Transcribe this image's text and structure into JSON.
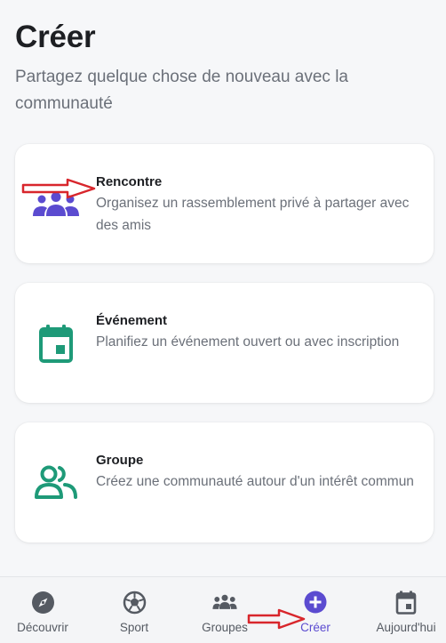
{
  "header": {
    "title": "Créer",
    "subtitle": "Partagez quelque chose de nouveau avec la communauté"
  },
  "options": [
    {
      "title": "Rencontre",
      "description": "Organisez un rassemblement privé à partager avec des amis",
      "icon": "group-people-icon",
      "color": "#5b4bd0"
    },
    {
      "title": "Événement",
      "description": "Planifiez un événement ouvert ou avec inscription",
      "icon": "calendar-icon",
      "color": "#1e9a78"
    },
    {
      "title": "Groupe",
      "description": "Créez une communauté autour d'un intérêt commun",
      "icon": "people-icon",
      "color": "#1e9a78"
    }
  ],
  "nav": {
    "items": [
      {
        "label": "Découvrir",
        "icon": "compass-icon"
      },
      {
        "label": "Sport",
        "icon": "ball-icon"
      },
      {
        "label": "Groupes",
        "icon": "groups-icon"
      },
      {
        "label": "Créer",
        "icon": "plus-circle-icon",
        "active": true
      },
      {
        "label": "Aujourd'hui",
        "icon": "calendar-icon"
      }
    ],
    "active_color": "#5b4bd0"
  },
  "annotations": {
    "arrow_color": "#d8262c"
  }
}
